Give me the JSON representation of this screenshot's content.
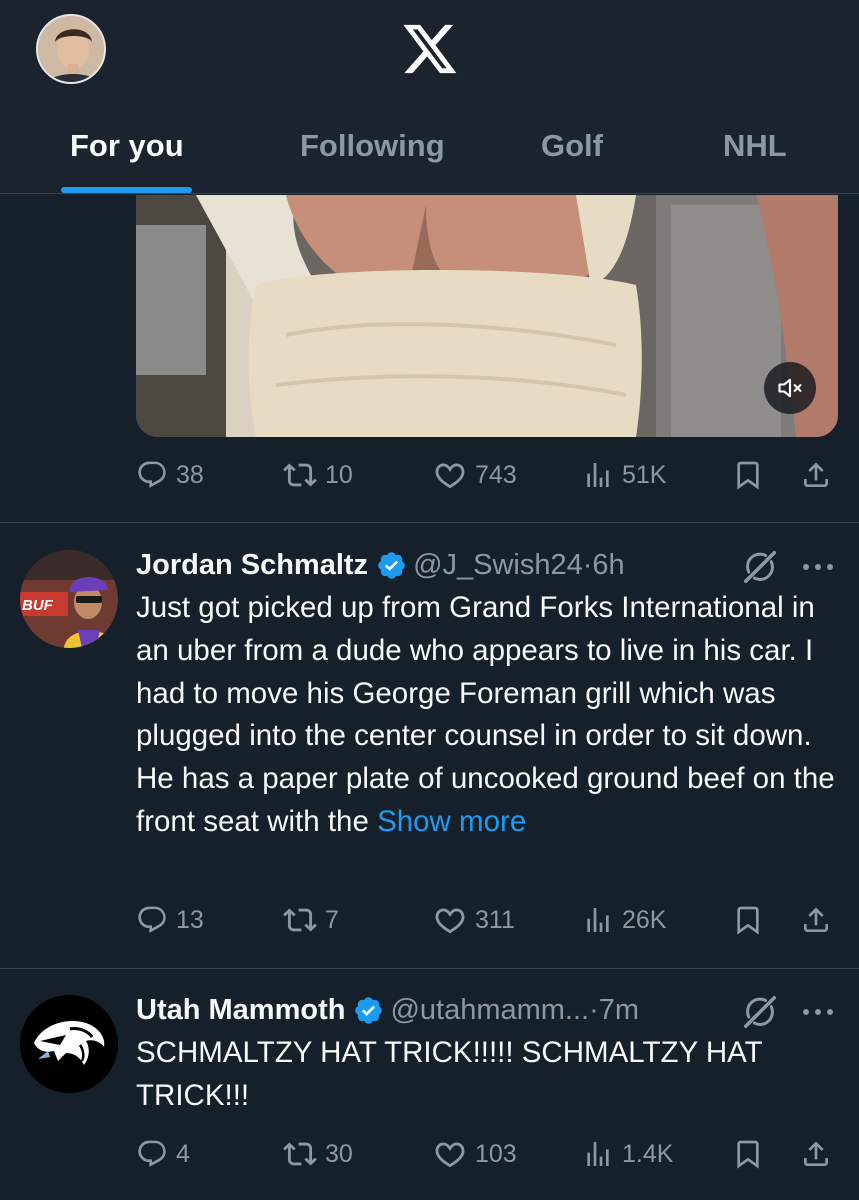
{
  "header": {
    "profile_avatar_alt": "profile avatar",
    "logo": "X",
    "tabs": [
      {
        "label": "For you",
        "active": true
      },
      {
        "label": "Following",
        "active": false
      },
      {
        "label": "Golf",
        "active": false
      },
      {
        "label": "NHL",
        "active": false
      }
    ]
  },
  "colors": {
    "background": "#15202b",
    "accent": "#1d9bf0",
    "muted_text": "#8b98a5",
    "divider": "#38444d"
  },
  "tweets": [
    {
      "media": {
        "type": "video",
        "muted_icon": "speaker-muted-icon"
      },
      "actions": {
        "replies": "38",
        "reposts": "10",
        "likes": "743",
        "views": "51K"
      }
    },
    {
      "name": "Jordan Schmaltz",
      "handle": "@J_Swish24",
      "separator": "·",
      "time": "6h",
      "text": "Just got picked up from Grand Forks International in an uber from a dude who appears to live in his car. I had to move his George Foreman grill which was plugged into the center counsel in order to sit down. He has a paper plate of uncooked ground beef on the front seat with the",
      "show_more": "Show more",
      "actions": {
        "replies": "13",
        "reposts": "7",
        "likes": "311",
        "views": "26K"
      }
    },
    {
      "name": "Utah Mammoth",
      "handle": "@utahmamm...",
      "separator": "·",
      "time": "7m",
      "text": "SCHMALTZY HAT TRICK!!!!! SCHMALTZY HAT TRICK!!!",
      "actions": {
        "replies": "4",
        "reposts": "30",
        "likes": "103",
        "views": "1.4K"
      }
    }
  ]
}
